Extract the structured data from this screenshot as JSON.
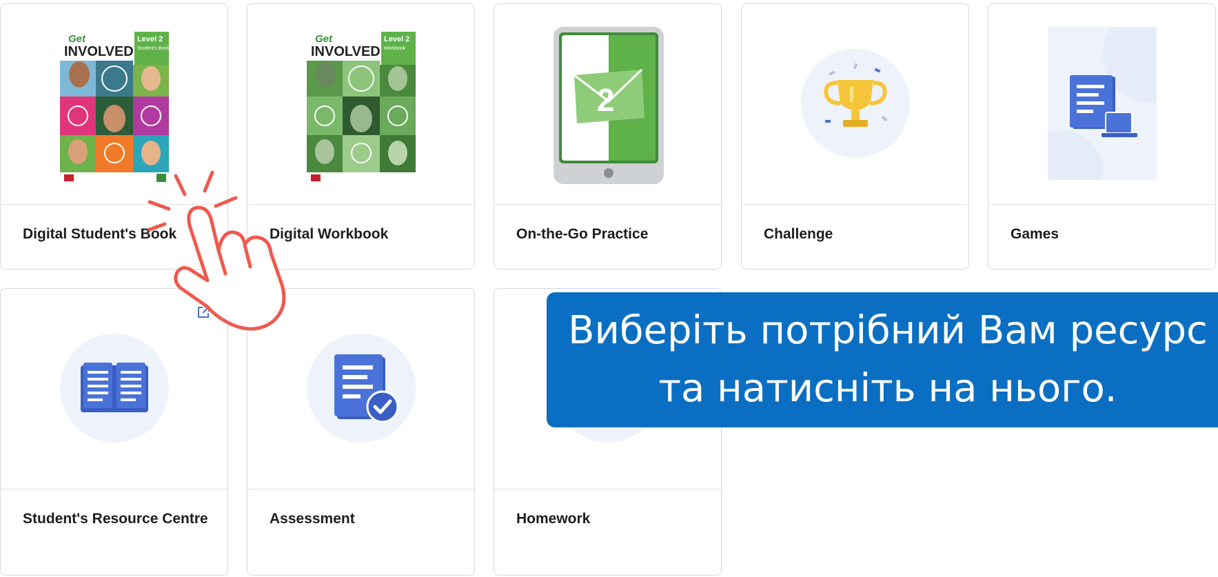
{
  "cards": [
    {
      "id": "digital-students-book",
      "label": "Digital Student's Book"
    },
    {
      "id": "digital-workbook",
      "label": "Digital Workbook"
    },
    {
      "id": "on-the-go-practice",
      "label": "On-the-Go Practice"
    },
    {
      "id": "challenge",
      "label": "Challenge"
    },
    {
      "id": "games",
      "label": "Games"
    },
    {
      "id": "students-resource-centre",
      "label": "Student's Resource Centre"
    },
    {
      "id": "assessment",
      "label": "Assessment"
    },
    {
      "id": "homework",
      "label": "Homework"
    }
  ],
  "covers": {
    "students_book": {
      "brand_top": "Get",
      "brand_main": "INVOLVED!",
      "level": "Level 2",
      "book_type": "Student's Book"
    },
    "workbook": {
      "brand_top": "Get",
      "brand_main": "INVOLVED!",
      "level": "Level 2",
      "book_type": "Workbook"
    }
  },
  "practice_badge": "2",
  "banner": {
    "line1": "Виберіть потрібний Вам ресурс",
    "line2": "та натисніть на нього."
  },
  "icons": {
    "cursor": "pointing-hand-icon",
    "external": "external-link-icon",
    "challenge": "trophy-icon",
    "games": "document-laptop-icon",
    "resource": "open-book-icon",
    "assessment": "document-check-icon"
  },
  "colors": {
    "banner": "#0a6fc2",
    "icon_blue": "#4a72d8",
    "circle_bg": "#eef2fb",
    "hand": "#ee5a4f",
    "students_green": "#5fb24a",
    "workbook_green": "#4a9a3e"
  }
}
